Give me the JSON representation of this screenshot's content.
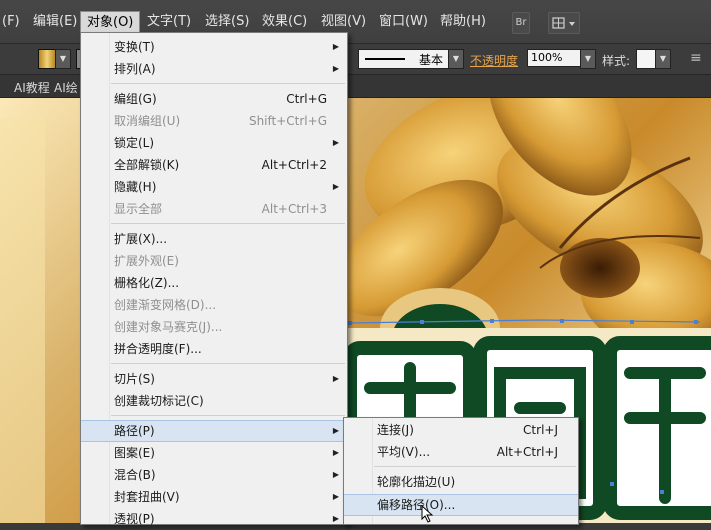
{
  "menubar": {
    "items": [
      {
        "label": "(F)"
      },
      {
        "label": "编辑(E)"
      },
      {
        "label": "对象(O)"
      },
      {
        "label": "文字(T)"
      },
      {
        "label": "选择(S)"
      },
      {
        "label": "效果(C)"
      },
      {
        "label": "视图(V)"
      },
      {
        "label": "窗口(W)"
      },
      {
        "label": "帮助(H)"
      }
    ],
    "bridge_label": "Br"
  },
  "controlbar": {
    "stroke_style_label": "基本",
    "opacity_label": "不透明度",
    "opacity_value": "100%",
    "style_label": "样式:"
  },
  "tabs": [
    {
      "label": "AI教程"
    },
    {
      "label": "AI绘"
    }
  ],
  "object_menu": {
    "items": [
      {
        "label": "变换(T)",
        "shortcut": "",
        "submenu": true,
        "disabled": false
      },
      {
        "label": "排列(A)",
        "shortcut": "",
        "submenu": true,
        "disabled": false
      },
      {
        "label": "编组(G)",
        "shortcut": "Ctrl+G",
        "submenu": false,
        "disabled": false
      },
      {
        "label": "取消编组(U)",
        "shortcut": "Shift+Ctrl+G",
        "submenu": false,
        "disabled": true
      },
      {
        "label": "锁定(L)",
        "shortcut": "",
        "submenu": true,
        "disabled": false
      },
      {
        "label": "全部解锁(K)",
        "shortcut": "Alt+Ctrl+2",
        "submenu": false,
        "disabled": false
      },
      {
        "label": "隐藏(H)",
        "shortcut": "",
        "submenu": true,
        "disabled": false
      },
      {
        "label": "显示全部",
        "shortcut": "Alt+Ctrl+3",
        "submenu": false,
        "disabled": true
      },
      {
        "label": "扩展(X)...",
        "shortcut": "",
        "submenu": false,
        "disabled": false
      },
      {
        "label": "扩展外观(E)",
        "shortcut": "",
        "submenu": false,
        "disabled": true
      },
      {
        "label": "栅格化(Z)...",
        "shortcut": "",
        "submenu": false,
        "disabled": false
      },
      {
        "label": "创建渐变网格(D)...",
        "shortcut": "",
        "submenu": false,
        "disabled": true
      },
      {
        "label": "创建对象马赛克(J)...",
        "shortcut": "",
        "submenu": false,
        "disabled": true
      },
      {
        "label": "拼合透明度(F)...",
        "shortcut": "",
        "submenu": false,
        "disabled": false
      },
      {
        "label": "切片(S)",
        "shortcut": "",
        "submenu": true,
        "disabled": false
      },
      {
        "label": "创建裁切标记(C)",
        "shortcut": "",
        "submenu": false,
        "disabled": false
      },
      {
        "label": "路径(P)",
        "shortcut": "",
        "submenu": true,
        "disabled": false,
        "highlighted": true
      },
      {
        "label": "图案(E)",
        "shortcut": "",
        "submenu": true,
        "disabled": false
      },
      {
        "label": "混合(B)",
        "shortcut": "",
        "submenu": true,
        "disabled": false
      },
      {
        "label": "封套扭曲(V)",
        "shortcut": "",
        "submenu": true,
        "disabled": false
      },
      {
        "label": "透视(P)",
        "shortcut": "",
        "submenu": true,
        "disabled": false
      }
    ]
  },
  "path_submenu": {
    "items": [
      {
        "label": "连接(J)",
        "shortcut": "Ctrl+J"
      },
      {
        "label": "平均(V)...",
        "shortcut": "Alt+Ctrl+J"
      },
      {
        "label": "轮廓化描边(U)",
        "shortcut": ""
      },
      {
        "label": "偏移路径(O)...",
        "shortcut": "",
        "highlighted": true
      }
    ]
  }
}
